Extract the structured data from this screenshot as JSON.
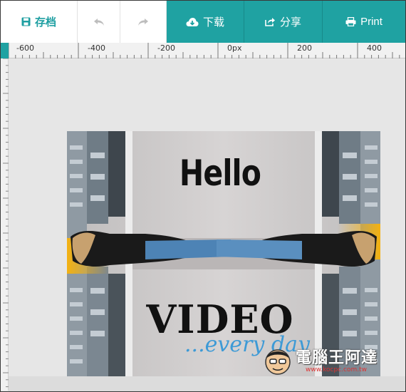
{
  "toolbar": {
    "save_label": "存档",
    "download_label": "下载",
    "share_label": "分享",
    "print_label": "Print"
  },
  "ruler": {
    "labels": [
      "-600",
      "-400",
      "-200",
      "0px",
      "200",
      "400"
    ]
  },
  "canvas": {
    "headline": "Hello",
    "title": "VIDEO",
    "tagline": "...every day"
  },
  "watermark": {
    "brand": "電腦王阿達",
    "url": "www.kocpc.com.tw"
  },
  "colors": {
    "accent": "#1fa2a2",
    "accent_text": "#1f9fa2",
    "tagline": "#3d9ad6"
  },
  "icons": [
    "save-icon",
    "undo-icon",
    "redo-icon",
    "cloud-download-icon",
    "share-icon",
    "print-icon"
  ]
}
